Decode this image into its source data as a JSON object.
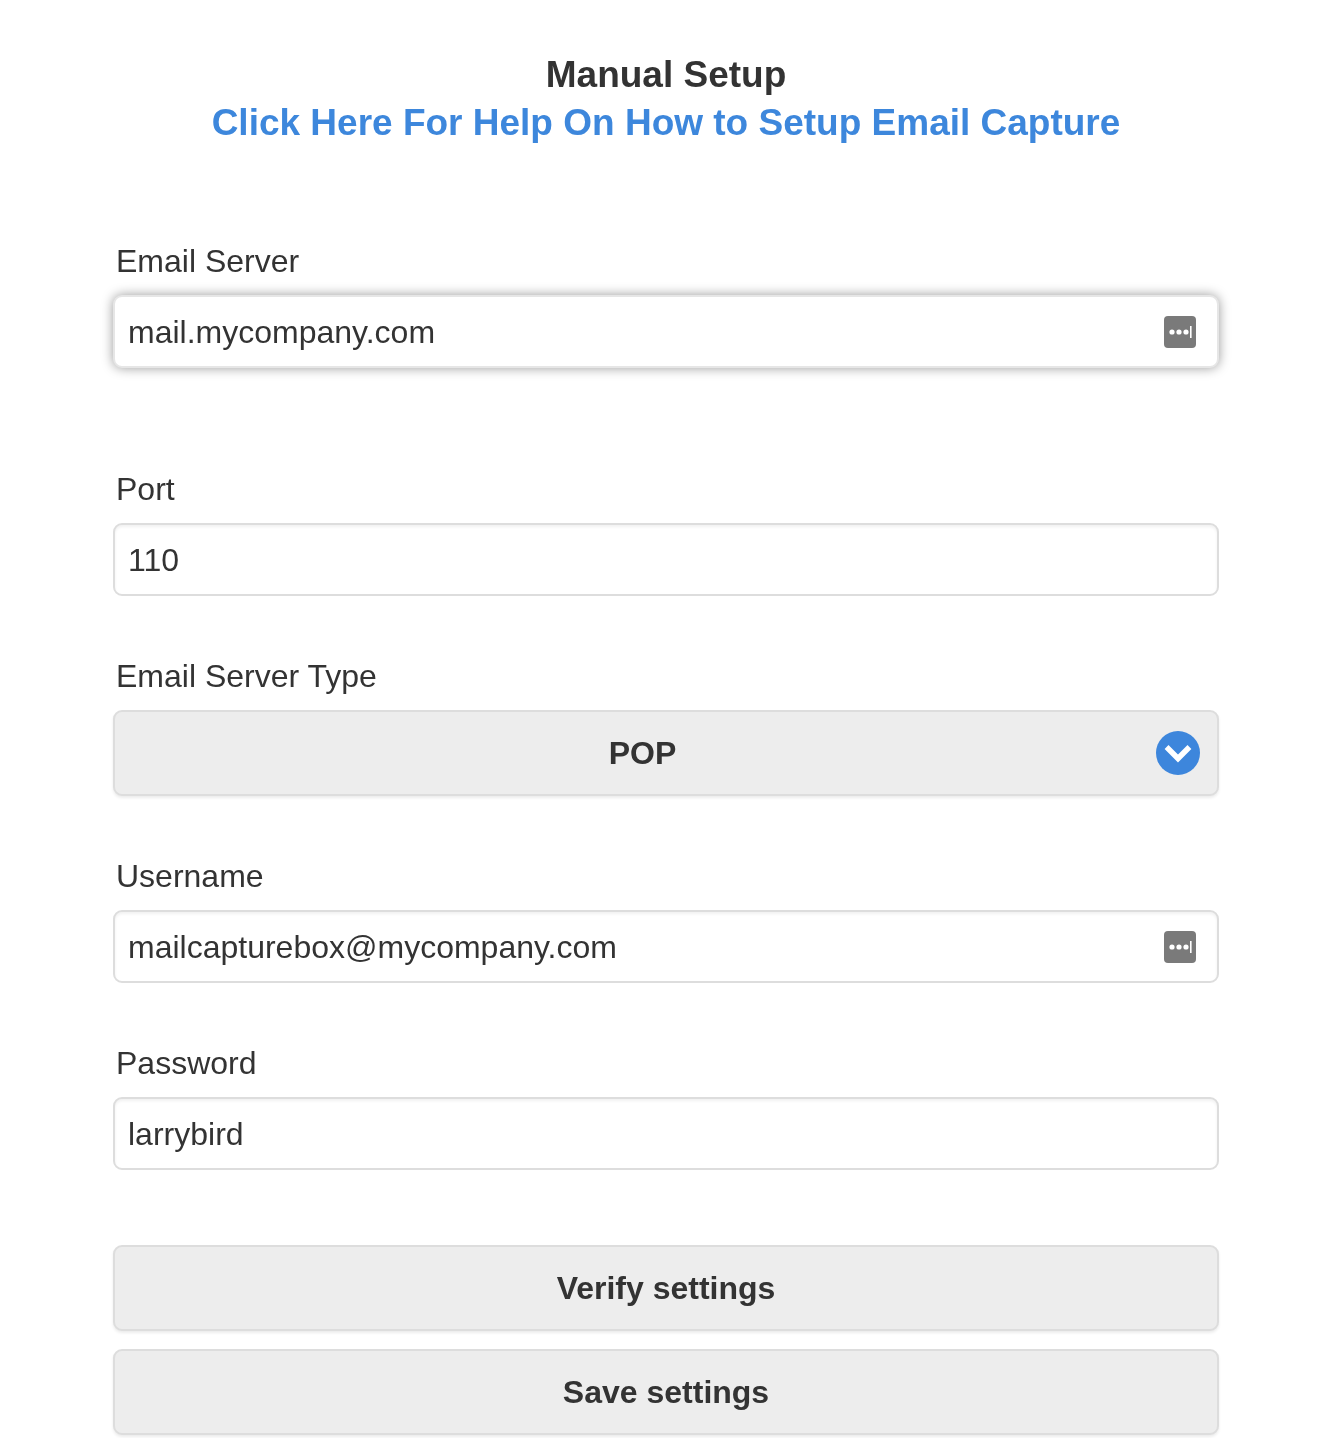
{
  "header": {
    "title": "Manual Setup",
    "help_link": "Click Here For Help On How to Setup Email Capture"
  },
  "fields": [
    {
      "kind": "input",
      "label": "Email Server",
      "value": "mail.mycompany.com",
      "focused": true,
      "autofill_icon": true
    },
    {
      "kind": "input",
      "label": "Port",
      "value": "110",
      "focused": false,
      "autofill_icon": false
    },
    {
      "kind": "select",
      "label": "Email Server Type",
      "value": "POP",
      "focused": false
    },
    {
      "kind": "input",
      "label": "Username",
      "value": "mailcapturebox@mycompany.com",
      "focused": false,
      "autofill_icon": true
    },
    {
      "kind": "input",
      "label": "Password",
      "value": "larrybird",
      "focused": false,
      "autofill_icon": false
    }
  ],
  "buttons": [
    "Verify settings",
    "Save settings"
  ]
}
